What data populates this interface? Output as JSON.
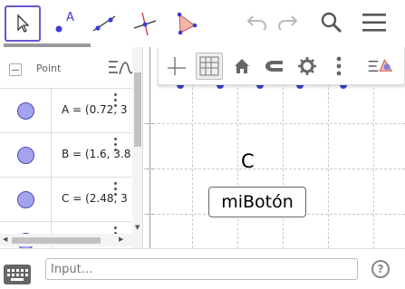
{
  "toolbar": {
    "tools": [
      {
        "name": "move-tool",
        "selected": true
      },
      {
        "name": "point-tool",
        "glyph": "A"
      },
      {
        "name": "line-tool"
      },
      {
        "name": "perpendicular-line-tool"
      },
      {
        "name": "polygon-tool"
      }
    ],
    "icons": [
      "undo-icon",
      "redo-icon",
      "search-icon",
      "menu-icon"
    ]
  },
  "algebra": {
    "header_label": "Point",
    "rows": [
      {
        "text": "A = (0.72, 3"
      },
      {
        "text": "B = (1.6, 3.8"
      },
      {
        "text": "C = (2.48, 3"
      }
    ],
    "dot_color": "#a3a3f0"
  },
  "graphics": {
    "point_label": "C",
    "button_label": "miBotón",
    "point_color": "#3b3bd6"
  },
  "style_bar": {
    "buttons": [
      "show-axes-icon",
      "show-grid-icon",
      "standard-view-icon",
      "point-capturing-icon",
      "settings-icon",
      "more-icon",
      "toggle-style-bar-icon"
    ]
  },
  "input": {
    "placeholder": "Input…"
  },
  "help": {
    "label": "?"
  }
}
